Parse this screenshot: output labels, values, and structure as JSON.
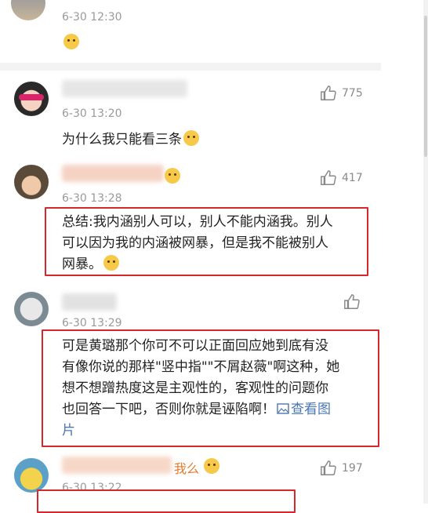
{
  "comments": [
    {
      "time": "6-30 12:30",
      "text": "",
      "likes": ""
    },
    {
      "time": "6-30 13:20",
      "text": "为什么我只能看三条",
      "likes": "775"
    },
    {
      "time": "6-30 13:28",
      "text_lines": [
        "总结:我内涵别人可以，别人不能内涵我。别人",
        "可以因为我的内涵被网暴，但是我不能被别人",
        "网暴。"
      ],
      "likes": "417"
    },
    {
      "time": "6-30 13:29",
      "text_lines": [
        "可是黄璐那个你可不可以正面回应她到底有没",
        "有像你说的那样\"竖中指\"\"不屑赵薇\"啊这种，她",
        "想不想蹭热度这是主观性的，客观性的问题你",
        "也回答一下吧，否则你就是诬陷啊！"
      ],
      "view_image_label": "查看图",
      "view_image_tail": "片",
      "likes": ""
    },
    {
      "name_suffix": "我么",
      "time": "6-30 13:22",
      "likes": "197"
    }
  ],
  "colors": {
    "highlight": "#d6272d",
    "link": "#4a77b2",
    "muted": "#9a9a9a"
  },
  "icons": [
    "thumbs-up-icon",
    "image-icon",
    "emoji-icon"
  ]
}
